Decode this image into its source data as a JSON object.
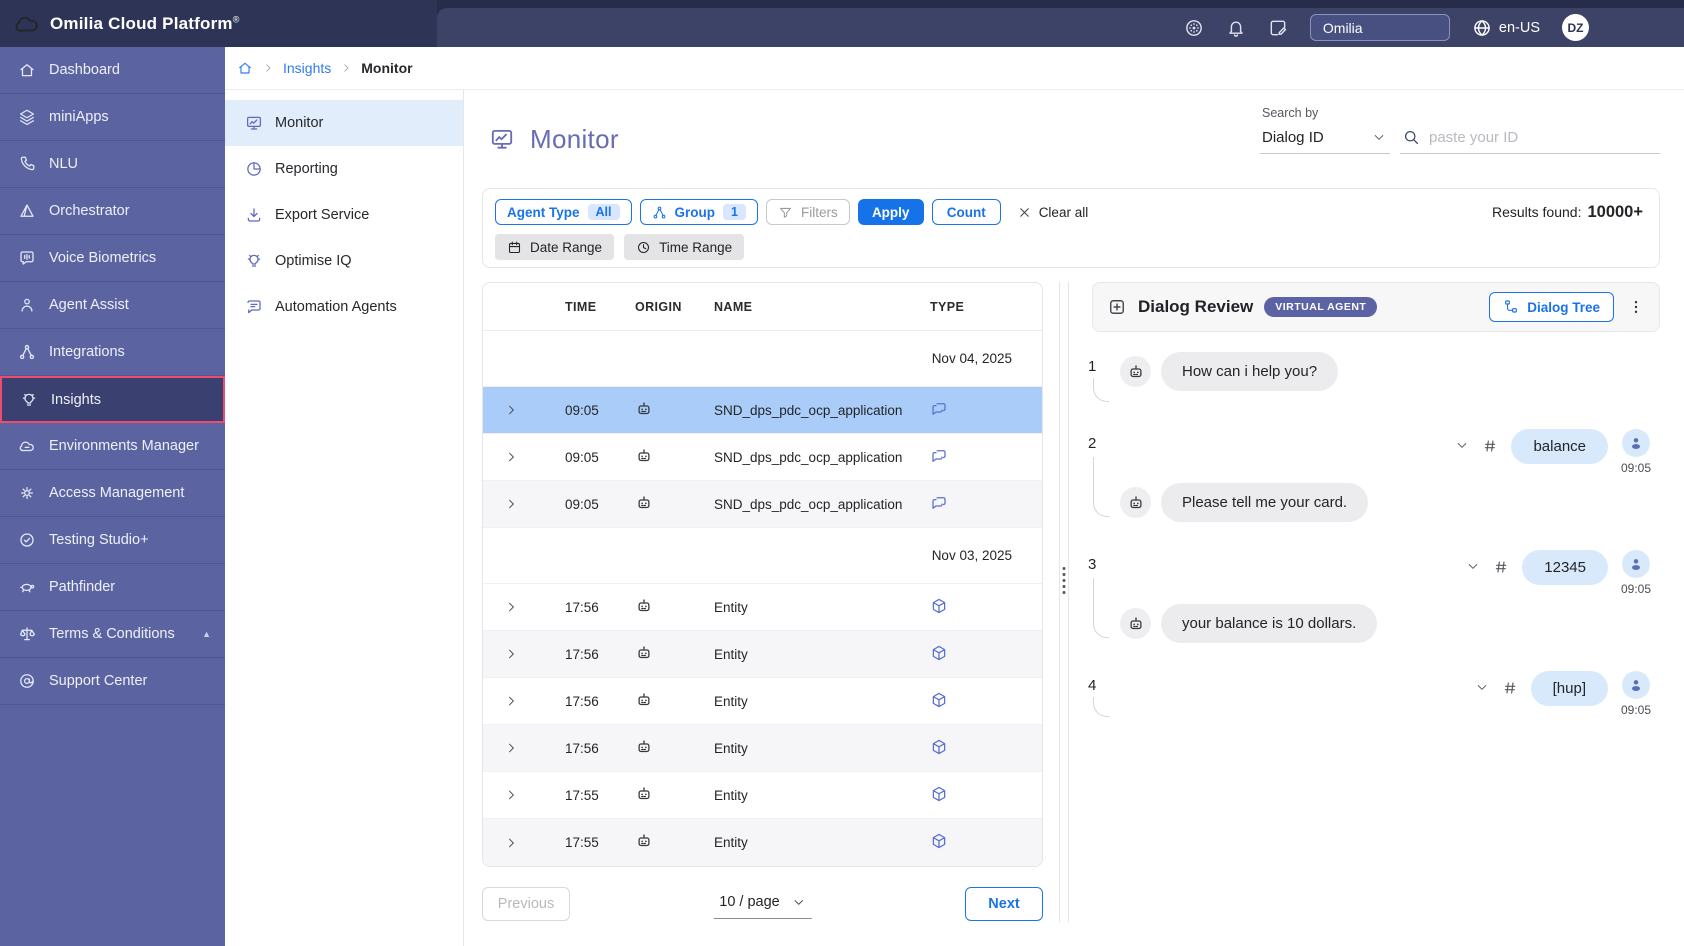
{
  "topbar": {
    "logo": "Omilia Cloud Platform",
    "logo_mark": "®",
    "tenant": "Omilia",
    "locale": "en-US",
    "avatar_initials": "DZ"
  },
  "sidebar": {
    "items": [
      {
        "label": "Dashboard",
        "icon": "home-icon"
      },
      {
        "label": "miniApps",
        "icon": "layers-icon"
      },
      {
        "label": "NLU",
        "icon": "phone-icon"
      },
      {
        "label": "Orchestrator",
        "icon": "triangle-icon"
      },
      {
        "label": "Voice Biometrics",
        "icon": "voice-bubble-icon"
      },
      {
        "label": "Agent Assist",
        "icon": "person-icon"
      },
      {
        "label": "Integrations",
        "icon": "nodes-icon"
      },
      {
        "label": "Insights",
        "icon": "lightbulb-icon",
        "selected": true
      },
      {
        "label": "Environments Manager",
        "icon": "cloud-icon"
      },
      {
        "label": "Access Management",
        "icon": "gear-icon"
      },
      {
        "label": "Testing Studio+",
        "icon": "badge-check-icon"
      },
      {
        "label": "Pathfinder",
        "icon": "turtle-icon"
      },
      {
        "label": "Terms & Conditions",
        "icon": "scales-icon",
        "caret": "▲"
      },
      {
        "label": "Support Center",
        "icon": "at-sign-icon"
      }
    ]
  },
  "breadcrumb": {
    "link": "Insights",
    "current": "Monitor"
  },
  "subnav": {
    "items": [
      {
        "label": "Monitor",
        "selected": true
      },
      {
        "label": "Reporting"
      },
      {
        "label": "Export Service"
      },
      {
        "label": "Optimise IQ"
      },
      {
        "label": "Automation Agents"
      }
    ]
  },
  "header": {
    "title": "Monitor",
    "search_by": "Search by",
    "search_type": "Dialog ID",
    "search_placeholder": "paste your ID"
  },
  "toolbar": {
    "agent_type": {
      "label": "Agent Type",
      "value": "All"
    },
    "group": {
      "label": "Group",
      "value": "1"
    },
    "filters": "Filters",
    "apply": "Apply",
    "count": "Count",
    "clear_all": "Clear all",
    "date_range": "Date Range",
    "time_range": "Time Range",
    "results_label": "Results found:",
    "results_value": "10000+"
  },
  "table": {
    "columns": [
      "TIME",
      "ORIGIN",
      "NAME",
      "TYPE"
    ],
    "groups": [
      {
        "date": "Nov 04, 2025",
        "rows": [
          {
            "time": "09:05",
            "origin": "bot",
            "name": "SND_dps_pdc_ocp_application",
            "type": "chat",
            "selected": true
          },
          {
            "time": "09:05",
            "origin": "bot",
            "name": "SND_dps_pdc_ocp_application",
            "type": "chat"
          },
          {
            "time": "09:05",
            "origin": "bot",
            "name": "SND_dps_pdc_ocp_application",
            "type": "chat"
          }
        ]
      },
      {
        "date": "Nov 03, 2025",
        "rows": [
          {
            "time": "17:56",
            "origin": "bot",
            "name": "Entity",
            "type": "entity"
          },
          {
            "time": "17:56",
            "origin": "bot",
            "name": "Entity",
            "type": "entity"
          },
          {
            "time": "17:56",
            "origin": "bot",
            "name": "Entity",
            "type": "entity"
          },
          {
            "time": "17:56",
            "origin": "bot",
            "name": "Entity",
            "type": "entity"
          },
          {
            "time": "17:55",
            "origin": "bot",
            "name": "Entity",
            "type": "entity"
          },
          {
            "time": "17:55",
            "origin": "bot",
            "name": "Entity",
            "type": "entity"
          }
        ]
      }
    ],
    "pagination": {
      "previous": "Previous",
      "page_size": "10 / page",
      "next": "Next"
    }
  },
  "dialog": {
    "title": "Dialog Review",
    "badge": "VIRTUAL AGENT",
    "tree_button": "Dialog Tree",
    "turns": [
      {
        "n": "1",
        "bot": "How can i help you?"
      },
      {
        "n": "2",
        "user": "balance",
        "time": "09:05",
        "bot": "Please tell me your card."
      },
      {
        "n": "3",
        "user": "12345",
        "time": "09:05",
        "bot": "your balance is 10 dollars."
      },
      {
        "n": "4",
        "user": "[hup]",
        "time": "09:05"
      }
    ]
  },
  "colors": {
    "accent_blue": "#1a73e8",
    "topbar": "#2e3456",
    "sidebar": "#5b64a0",
    "sidebar_selected_border": "#ee4b6e",
    "selected_row": "#a9cdf8",
    "title_purple": "#676cb4",
    "badge_indigo": "#5c63a5",
    "user_bubble": "#d9e9fc",
    "bot_bubble": "#ececee"
  }
}
